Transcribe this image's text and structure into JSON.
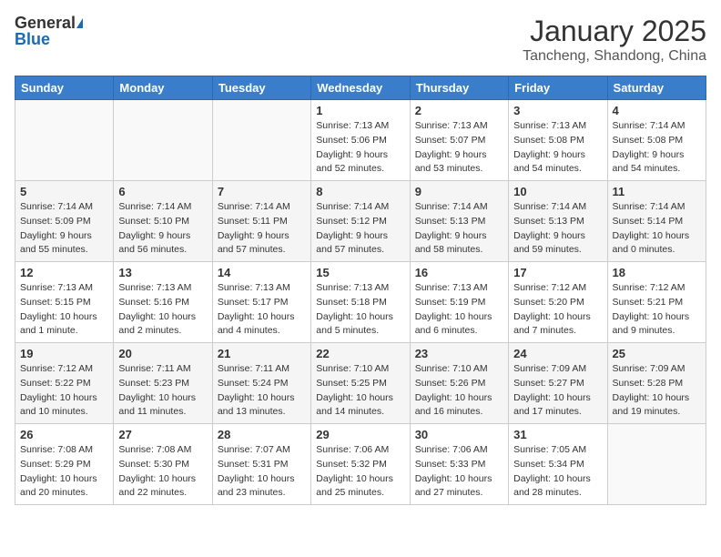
{
  "header": {
    "logo_general": "General",
    "logo_blue": "Blue",
    "title": "January 2025",
    "location": "Tancheng, Shandong, China"
  },
  "weekdays": [
    "Sunday",
    "Monday",
    "Tuesday",
    "Wednesday",
    "Thursday",
    "Friday",
    "Saturday"
  ],
  "weeks": [
    [
      {
        "day": "",
        "info": ""
      },
      {
        "day": "",
        "info": ""
      },
      {
        "day": "",
        "info": ""
      },
      {
        "day": "1",
        "info": "Sunrise: 7:13 AM\nSunset: 5:06 PM\nDaylight: 9 hours and 52 minutes."
      },
      {
        "day": "2",
        "info": "Sunrise: 7:13 AM\nSunset: 5:07 PM\nDaylight: 9 hours and 53 minutes."
      },
      {
        "day": "3",
        "info": "Sunrise: 7:13 AM\nSunset: 5:08 PM\nDaylight: 9 hours and 54 minutes."
      },
      {
        "day": "4",
        "info": "Sunrise: 7:14 AM\nSunset: 5:08 PM\nDaylight: 9 hours and 54 minutes."
      }
    ],
    [
      {
        "day": "5",
        "info": "Sunrise: 7:14 AM\nSunset: 5:09 PM\nDaylight: 9 hours and 55 minutes."
      },
      {
        "day": "6",
        "info": "Sunrise: 7:14 AM\nSunset: 5:10 PM\nDaylight: 9 hours and 56 minutes."
      },
      {
        "day": "7",
        "info": "Sunrise: 7:14 AM\nSunset: 5:11 PM\nDaylight: 9 hours and 57 minutes."
      },
      {
        "day": "8",
        "info": "Sunrise: 7:14 AM\nSunset: 5:12 PM\nDaylight: 9 hours and 57 minutes."
      },
      {
        "day": "9",
        "info": "Sunrise: 7:14 AM\nSunset: 5:13 PM\nDaylight: 9 hours and 58 minutes."
      },
      {
        "day": "10",
        "info": "Sunrise: 7:14 AM\nSunset: 5:13 PM\nDaylight: 9 hours and 59 minutes."
      },
      {
        "day": "11",
        "info": "Sunrise: 7:14 AM\nSunset: 5:14 PM\nDaylight: 10 hours and 0 minutes."
      }
    ],
    [
      {
        "day": "12",
        "info": "Sunrise: 7:13 AM\nSunset: 5:15 PM\nDaylight: 10 hours and 1 minute."
      },
      {
        "day": "13",
        "info": "Sunrise: 7:13 AM\nSunset: 5:16 PM\nDaylight: 10 hours and 2 minutes."
      },
      {
        "day": "14",
        "info": "Sunrise: 7:13 AM\nSunset: 5:17 PM\nDaylight: 10 hours and 4 minutes."
      },
      {
        "day": "15",
        "info": "Sunrise: 7:13 AM\nSunset: 5:18 PM\nDaylight: 10 hours and 5 minutes."
      },
      {
        "day": "16",
        "info": "Sunrise: 7:13 AM\nSunset: 5:19 PM\nDaylight: 10 hours and 6 minutes."
      },
      {
        "day": "17",
        "info": "Sunrise: 7:12 AM\nSunset: 5:20 PM\nDaylight: 10 hours and 7 minutes."
      },
      {
        "day": "18",
        "info": "Sunrise: 7:12 AM\nSunset: 5:21 PM\nDaylight: 10 hours and 9 minutes."
      }
    ],
    [
      {
        "day": "19",
        "info": "Sunrise: 7:12 AM\nSunset: 5:22 PM\nDaylight: 10 hours and 10 minutes."
      },
      {
        "day": "20",
        "info": "Sunrise: 7:11 AM\nSunset: 5:23 PM\nDaylight: 10 hours and 11 minutes."
      },
      {
        "day": "21",
        "info": "Sunrise: 7:11 AM\nSunset: 5:24 PM\nDaylight: 10 hours and 13 minutes."
      },
      {
        "day": "22",
        "info": "Sunrise: 7:10 AM\nSunset: 5:25 PM\nDaylight: 10 hours and 14 minutes."
      },
      {
        "day": "23",
        "info": "Sunrise: 7:10 AM\nSunset: 5:26 PM\nDaylight: 10 hours and 16 minutes."
      },
      {
        "day": "24",
        "info": "Sunrise: 7:09 AM\nSunset: 5:27 PM\nDaylight: 10 hours and 17 minutes."
      },
      {
        "day": "25",
        "info": "Sunrise: 7:09 AM\nSunset: 5:28 PM\nDaylight: 10 hours and 19 minutes."
      }
    ],
    [
      {
        "day": "26",
        "info": "Sunrise: 7:08 AM\nSunset: 5:29 PM\nDaylight: 10 hours and 20 minutes."
      },
      {
        "day": "27",
        "info": "Sunrise: 7:08 AM\nSunset: 5:30 PM\nDaylight: 10 hours and 22 minutes."
      },
      {
        "day": "28",
        "info": "Sunrise: 7:07 AM\nSunset: 5:31 PM\nDaylight: 10 hours and 23 minutes."
      },
      {
        "day": "29",
        "info": "Sunrise: 7:06 AM\nSunset: 5:32 PM\nDaylight: 10 hours and 25 minutes."
      },
      {
        "day": "30",
        "info": "Sunrise: 7:06 AM\nSunset: 5:33 PM\nDaylight: 10 hours and 27 minutes."
      },
      {
        "day": "31",
        "info": "Sunrise: 7:05 AM\nSunset: 5:34 PM\nDaylight: 10 hours and 28 minutes."
      },
      {
        "day": "",
        "info": ""
      }
    ]
  ]
}
